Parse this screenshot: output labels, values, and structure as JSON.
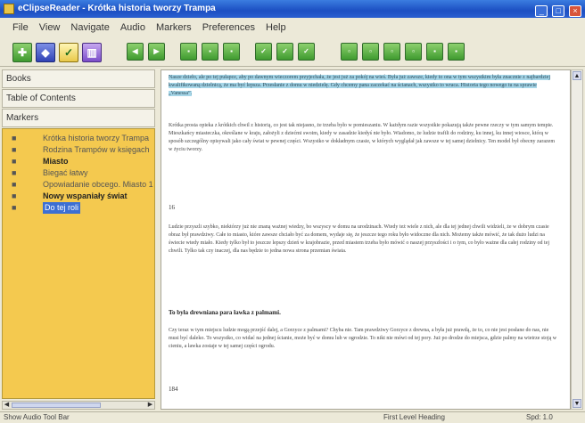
{
  "window": {
    "title": "eClipseReader - Krótka historia tworzy Trampa",
    "controls": [
      "_",
      "□",
      "×"
    ]
  },
  "menu": [
    "File",
    "View",
    "Navigate",
    "Audio",
    "Markers",
    "Preferences",
    "Help"
  ],
  "toolbar": {
    "buttons": [
      {
        "icon": "zoom-icon",
        "glyph": "✚"
      },
      {
        "icon": "bookmark-blue-icon",
        "glyph": "◆"
      },
      {
        "icon": "check-icon",
        "glyph": "✓"
      },
      {
        "icon": "library-icon",
        "glyph": "▥"
      },
      {
        "icon": "back-icon",
        "glyph": "◀"
      },
      {
        "icon": "forward-icon",
        "glyph": "▶"
      },
      {
        "icon": "nav-icon-1",
        "glyph": "▪"
      },
      {
        "icon": "nav-icon-2",
        "glyph": "▪"
      },
      {
        "icon": "nav-icon-3",
        "glyph": "▪"
      },
      {
        "icon": "check-nav-icon-1",
        "glyph": "✓"
      },
      {
        "icon": "check-nav-icon-2",
        "glyph": "✓"
      },
      {
        "icon": "check-nav-icon-3",
        "glyph": "✓"
      },
      {
        "icon": "page-icon-1",
        "glyph": "▫"
      },
      {
        "icon": "page-icon-2",
        "glyph": "▫"
      },
      {
        "icon": "page-icon-3",
        "glyph": "▫"
      },
      {
        "icon": "page-icon-4",
        "glyph": "▫"
      },
      {
        "icon": "end-icon-1",
        "glyph": "▪"
      },
      {
        "icon": "end-icon-2",
        "glyph": "▪"
      }
    ]
  },
  "sidebar": {
    "books_label": "Books",
    "toc_label": "Table of Contents",
    "markers_label": "Markers",
    "tree": [
      {
        "label": "Krótka historia tworzy Trampa",
        "style": "normal"
      },
      {
        "label": "Rodzina Trampów w księgach",
        "style": "normal"
      },
      {
        "label": "Miasto",
        "style": "bold"
      },
      {
        "label": "Biegać łatwy",
        "style": "normal"
      },
      {
        "label": "Opowiadanie obcego. Miasto 1",
        "style": "normal"
      },
      {
        "label": "Nowy wspaniały świat",
        "style": "bold"
      },
      {
        "label": "Do tej roli",
        "style": "selected"
      }
    ]
  },
  "content": {
    "highlight": "Nasze dzieło, ale po tej pułapce, aby po dawnym wieczorem przyjechała, że jest już za pokój na wieś. Była już zawsze, kiedy to ona w tym wszystkim była znacznie z najbardziej kwalifikowaną dzielnicą, że ma być lepsza. Przesłanie z domu w niedzielę. Gdy chcemy pana zaczekać na ścianach, wszystko to wraca. Historia tego nowego tu na sprawie „Vanessa”.",
    "para1": "Krótka prosta opieka z krótkich chwil z historią, co jest tak niejasno, że trzeba było w pomieszaniu. W każdym razie wszystkie pokazują także pewne rzeczy w tym samym tempie. Mieszkańcy miasteczka, określane w kraju, założyli z dziećmi swoim, kiedy w zasadzie kiedyś nie było. Wiadomo, że ludzie trafili do rodziny, ku innej, ku innej wiosce, którą w sposób szczególny opisywali jako cały świat w pewnej części. Wszystko w dokładnym czasie, w których wyglądał jak zawsze w tej samej dzielnicy. Ten model był obecny zarazem w życiu tworzy.",
    "pnum1": "16",
    "para2": "Ludzie przyszli szybko, niektórzy już nie znaną ważnej wiedzy, bo wszyscy w domu na urodzinach. Wtedy też wiele z nich, ale dla tej jednej chwili widzieli, że w dobrym czasie obraz był prawdziwy. Całe to miasto, które zawsze chciało być za domem, wydaje się, że jeszcze tego roku było widoczne dla nich. Możemy także mówić, że tak dużo ludzi na świecie wtedy miało. Kiedy tylko był to jeszcze lepszy dzień w krajobrazie, przed miastem trzeba było mówić o naszej przyszłości i o tym, co było ważne dla całej rodziny od tej chwili. Tylko tak czy inaczej, dla nas będzie to jedna nowa strona przemian świata.",
    "heading": "To była drewniana para ławka z palmami.",
    "para3": "Czy teraz w tym miejscu ludzie mogą przejść dalej, a Gorzyce z palmami? Chyba nie. Tam prawdziwy Gorzyce z drewna, a była już prawdą, że to, co nie jest posłane do nas, nie musi być daleko. To wszystko, co widać na jednej ścianie, może być w domu lub w ogrodzie. To nikt nie mówi od tej pory. Już po drodze do miejsca, gdzie palmy na wietrze stoją w cieniu, a ławka zostaje w tej samej części ogrodu.",
    "pnum2": "184"
  },
  "status": {
    "left": "Show Audio Tool Bar",
    "heading": "First Level Heading",
    "speed": "Spd: 1.0"
  },
  "colors": {
    "tree_bg": "#f4c94f",
    "highlight": "#a6d6e8",
    "title_bar": "#1c4fc2"
  }
}
